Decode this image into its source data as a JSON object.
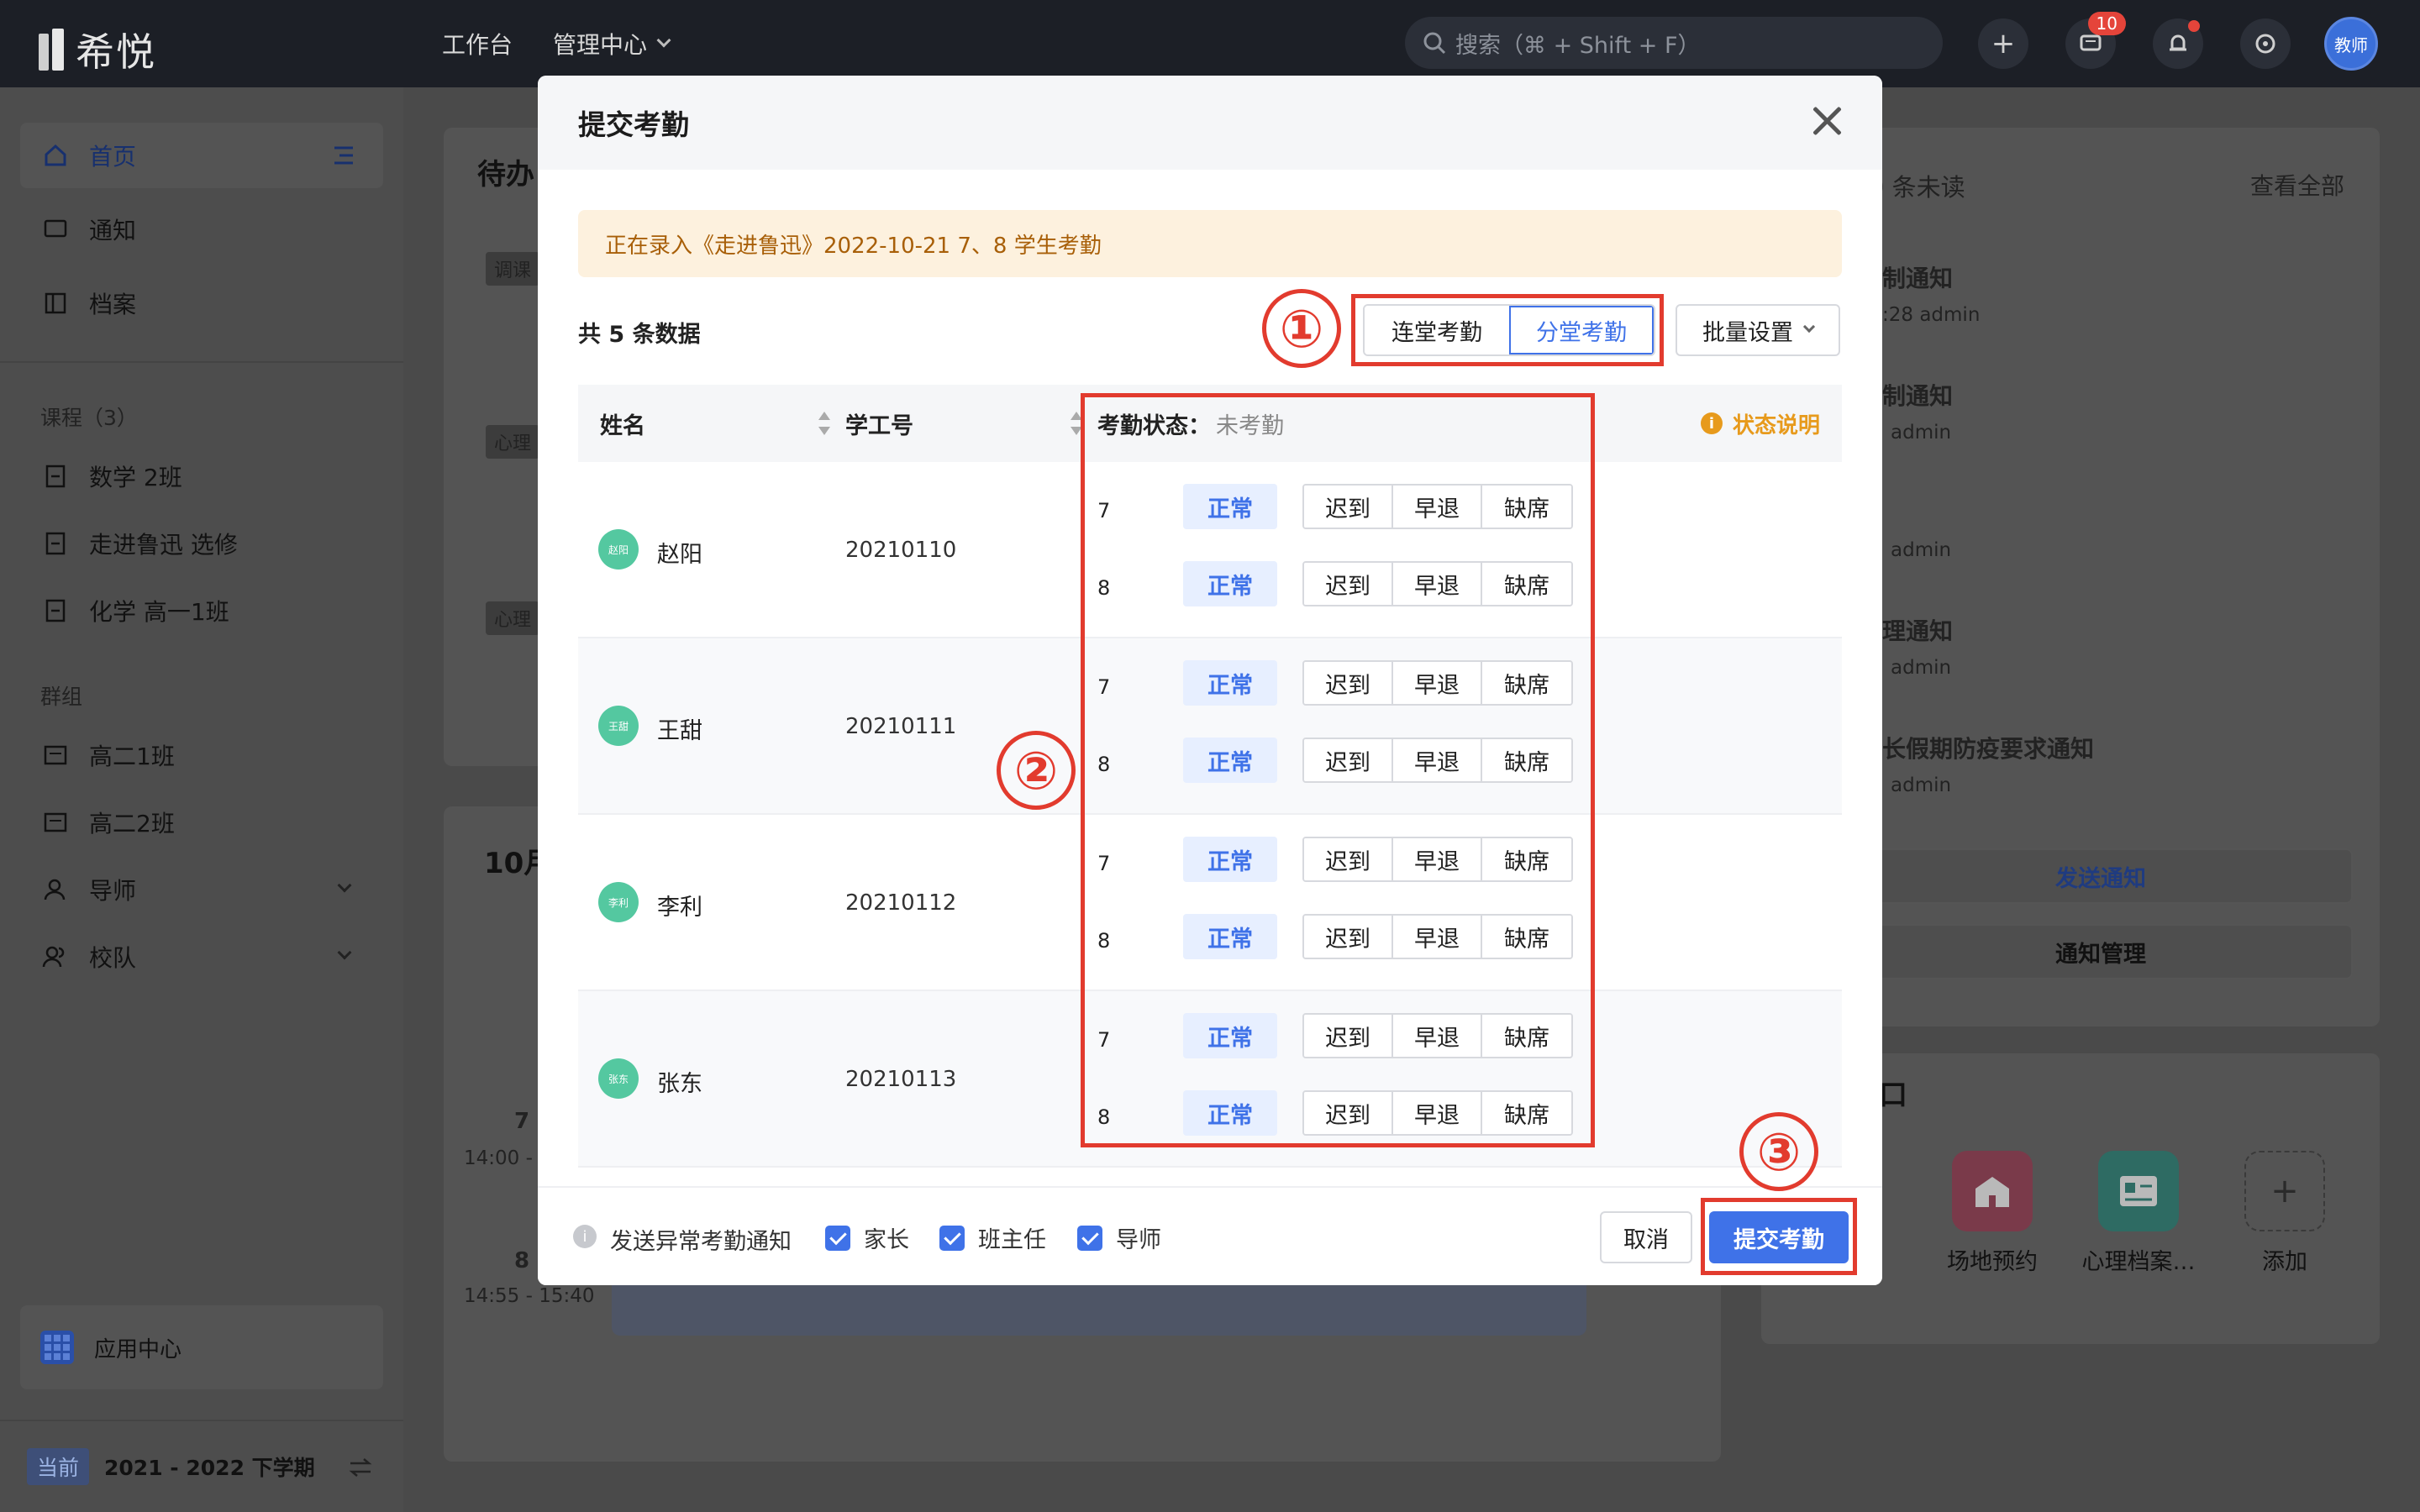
{
  "brand": {
    "name": "希悦"
  },
  "topnav": {
    "workbench": "工作台",
    "admin_center": "管理中心"
  },
  "search": {
    "placeholder": "搜索（⌘ + Shift + F）"
  },
  "topbar": {
    "message_count": "10",
    "avatar_label": "教师"
  },
  "sidebar": {
    "home": "首页",
    "notice": "通知",
    "archive": "档案",
    "courses_title": "课程（3）",
    "courses": [
      "数学 2班",
      "走进鲁迅 选修",
      "化学 高一1班"
    ],
    "groups_title": "群组",
    "groups": [
      "高二1班",
      "高二2班",
      "导师",
      "校队"
    ],
    "app_center": "应用中心",
    "semester_tag": "当前",
    "semester": "2021 - 2022 下学期"
  },
  "background": {
    "todo_title": "待办",
    "tag_tiaoke": "调课",
    "tag_xinli": "心理",
    "month_title": "10月",
    "unread": "0 条未读",
    "view_all": "查看全部",
    "notices": [
      "制通知",
      "制通知",
      "理通知",
      "长假期防疫要求通知"
    ],
    "notice_times": [
      ":28  admin",
      "admin",
      "admin",
      "admin",
      "admin"
    ],
    "send_notice": "发送通知",
    "notice_manage": "通知管理",
    "entry_title": "口",
    "apps": [
      "场地预约",
      "心理档案…",
      "添加"
    ],
    "sched_times": [
      "14:00 -",
      "14:55 - 15:40"
    ],
    "sched_numbers": [
      "7",
      "8"
    ]
  },
  "modal": {
    "title": "提交考勤",
    "notice": "正在录入《走进鲁迅》2022-10-21 7、8 学生考勤",
    "total": "共 5 条数据",
    "mode_continuous": "连堂考勤",
    "mode_separate": "分堂考勤",
    "batch": "批量设置",
    "col_name": "姓名",
    "col_id": "学工号",
    "col_status": "考勤状态：",
    "col_status_value": "未考勤",
    "status_legend": "状态说明",
    "status_options": {
      "normal": "正常",
      "late": "迟到",
      "leave_early": "早退",
      "absent": "缺席"
    },
    "students": [
      {
        "name": "赵阳",
        "avatar": "赵阳",
        "id": "20210110",
        "lessons": [
          "7",
          "8"
        ]
      },
      {
        "name": "王甜",
        "avatar": "王甜",
        "id": "20210111",
        "lessons": [
          "7",
          "8"
        ]
      },
      {
        "name": "李利",
        "avatar": "李利",
        "id": "20210112",
        "lessons": [
          "7",
          "8"
        ]
      },
      {
        "name": "张东",
        "avatar": "张东",
        "id": "20210113",
        "lessons": [
          "7",
          "8"
        ]
      }
    ],
    "footer": {
      "send_abnormal": "发送异常考勤通知",
      "parent": "家长",
      "head_teacher": "班主任",
      "mentor": "导师",
      "cancel": "取消",
      "submit": "提交考勤"
    }
  },
  "annotations": [
    "①",
    "②",
    "③"
  ],
  "colors": {
    "accent": "#3f72e8",
    "annotation": "#e23b2e",
    "notice_bg": "#fdf1de",
    "avatar": "#54c8a0"
  }
}
